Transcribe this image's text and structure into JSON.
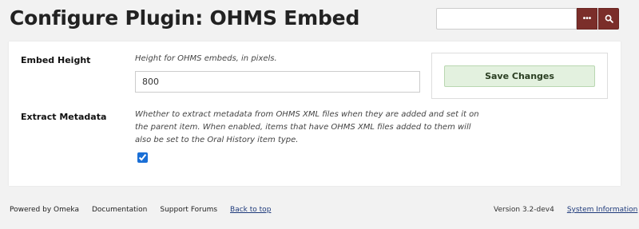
{
  "header": {
    "title": "Configure Plugin: OHMS Embed",
    "search": {
      "value": "",
      "placeholder": ""
    }
  },
  "icons": {
    "search_options": "ellipsis-icon",
    "search_submit": "search-icon"
  },
  "form": {
    "embed_height": {
      "label": "Embed Height",
      "explanation": "Height for OHMS embeds, in pixels.",
      "value": "800"
    },
    "extract_metadata": {
      "label": "Extract Metadata",
      "explanation_lines": [
        "Whether to extract metadata from OHMS XML files when they are added and set it on",
        "the parent item. When enabled, items that have OHMS XML files added to them will",
        "also be set to the Oral History item type."
      ],
      "checked": true
    }
  },
  "save": {
    "label": "Save Changes"
  },
  "footer": {
    "links_left": [
      "Powered by Omeka",
      "Documentation",
      "Support Forums",
      "Back to top"
    ],
    "version": "Version 3.2-dev4",
    "system_info": "System Information"
  },
  "colors": {
    "accent": "#7b2e2a",
    "save_bg": "#e3f1df",
    "link": "#1e3a7b"
  }
}
